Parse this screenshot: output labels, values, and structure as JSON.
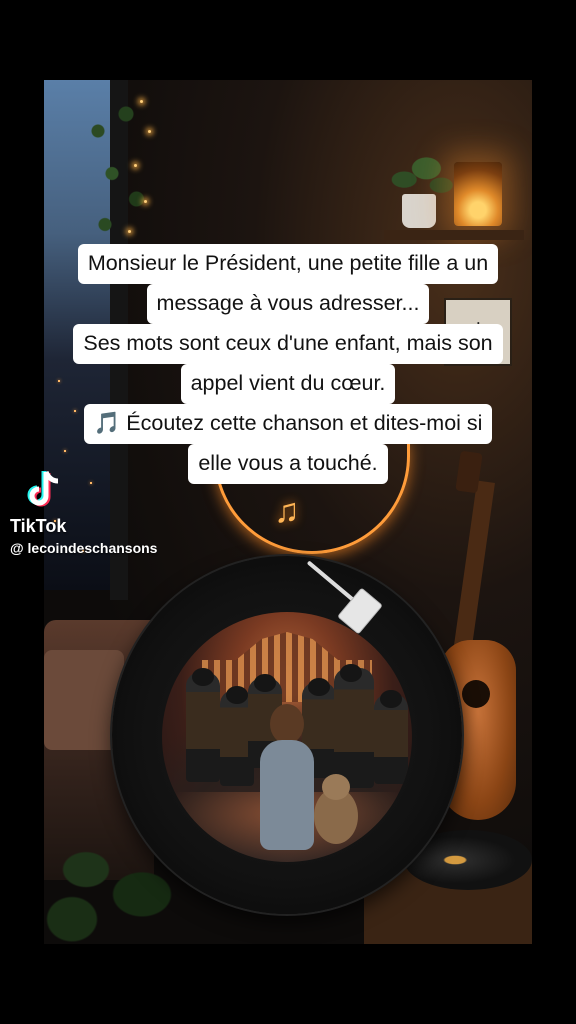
{
  "caption": {
    "lines": [
      "Monsieur le Président, une petite fille a un",
      "message à vous adresser...",
      "Ses mots sont ceux d'une enfant, mais son",
      "appel vient du cœur.",
      "🎵 Écoutez cette chanson et dites-moi si",
      "elle vous a touché."
    ]
  },
  "watermark": {
    "brand": "TikTok",
    "handle": "@ lecoindeschansons",
    "logo_icon": "tiktok-logo-icon"
  },
  "decor": {
    "neon_icon": "music-note-icon",
    "frame_icon": "music-note-icon",
    "accent": "#ff9c3a"
  }
}
